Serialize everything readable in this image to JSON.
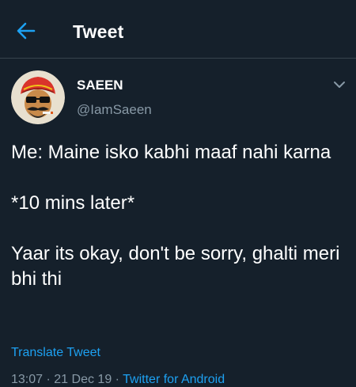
{
  "header": {
    "title": "Tweet",
    "back_icon": "arrow-left-icon"
  },
  "tweet": {
    "author": {
      "display_name": "SAEEN",
      "handle": "@IamSaeen"
    },
    "text": "Me: Maine isko kabhi maaf nahi karna\n\n*10 mins later*\n\nYaar its okay, don't be sorry, ghalti meri bhi thi",
    "translate_label": "Translate Tweet",
    "time": "13:07",
    "date": "21 Dec 19",
    "separator": "·",
    "source": "Twitter for Android",
    "menu_icon": "chevron-down-icon"
  },
  "colors": {
    "background": "#15202b",
    "accent": "#1da1f2",
    "secondary_text": "#8899a6",
    "divider": "#38444d"
  }
}
